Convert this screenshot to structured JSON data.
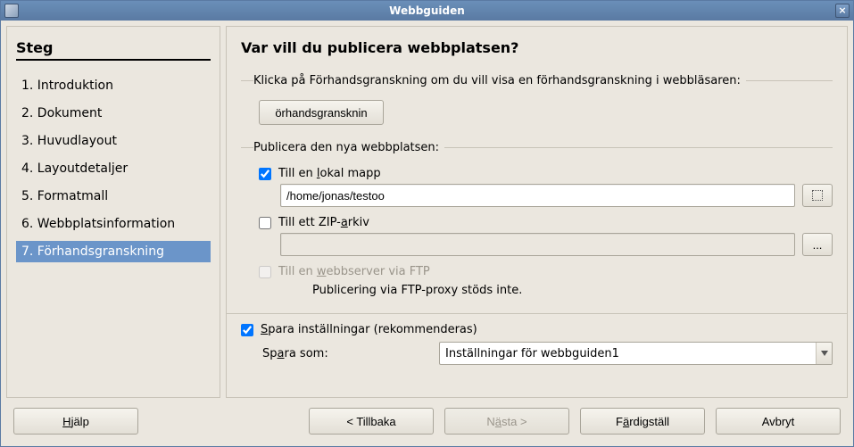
{
  "window": {
    "title": "Webbguiden"
  },
  "sidebar": {
    "heading": "Steg",
    "items": [
      {
        "label": "1. Introduktion"
      },
      {
        "label": "2. Dokument"
      },
      {
        "label": "3. Huvudlayout"
      },
      {
        "label": "4. Layoutdetaljer"
      },
      {
        "label": "5. Formatmall"
      },
      {
        "label": "6. Webbplatsinformation"
      },
      {
        "label": "7. Förhandsgranskning",
        "selected": true
      }
    ]
  },
  "main": {
    "heading": "Var vill du publicera webbplatsen?",
    "preview": {
      "legend": "Klicka på Förhandsgranskning om du vill visa en förhandsgranskning i webbläsaren:",
      "button_label": "örhandsgransknin"
    },
    "publish": {
      "legend": "Publicera den nya webbplatsen:",
      "local": {
        "checked": true,
        "label_pre": "Till en ",
        "label_u": "l",
        "label_post": "okal mapp",
        "value": "/home/jonas/testoo"
      },
      "zip": {
        "checked": false,
        "label_pre": "Till ett ZIP-",
        "label_u": "a",
        "label_post": "rkiv",
        "value": ""
      },
      "ftp": {
        "checked": false,
        "disabled": true,
        "label_pre": "Till en ",
        "label_u": "w",
        "label_post": "ebbserver via FTP",
        "message": "Publicering via FTP-proxy stöds inte."
      }
    },
    "save": {
      "checked": true,
      "label_u": "S",
      "label_post": "para inställningar (rekommenderas)",
      "as_label_pre": "Sp",
      "as_label_u": "a",
      "as_label_post": "ra som:",
      "selected": "Inställningar för webbguiden1"
    }
  },
  "buttons": {
    "help_u": "H",
    "help_post": "jälp",
    "back": "< Tillbaka",
    "next_pre": "N",
    "next_u": "ä",
    "next_post": "sta >",
    "finish_pre": "F",
    "finish_u": "ä",
    "finish_post": "rdigställ",
    "cancel": "Avbryt",
    "browse": "..."
  }
}
